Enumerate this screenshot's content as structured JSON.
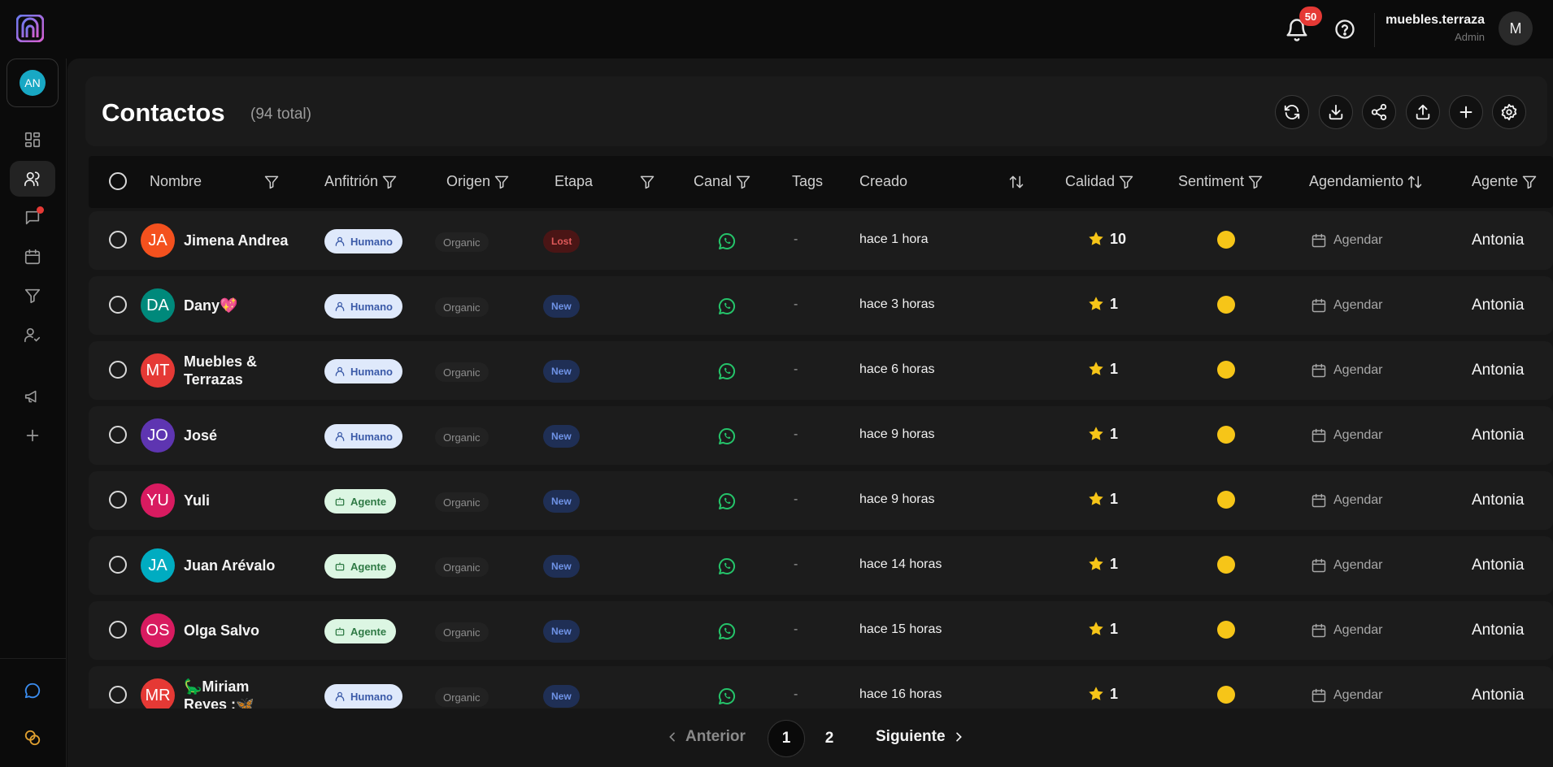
{
  "header": {
    "notification_count": "50",
    "username": "muebles.terraza",
    "role": "Admin",
    "user_initial": "M"
  },
  "sidebar": {
    "workspace_initials": "AN",
    "items": [
      {
        "icon": "dashboard-icon"
      },
      {
        "icon": "contacts-icon",
        "active": true
      },
      {
        "icon": "chat-icon",
        "notification": true
      },
      {
        "icon": "calendar-icon"
      },
      {
        "icon": "funnel-icon"
      },
      {
        "icon": "user-check-icon"
      },
      {
        "icon": "megaphone-icon"
      },
      {
        "icon": "plus-icon"
      },
      {
        "icon": "chat-bubble-icon"
      },
      {
        "icon": "coins-icon"
      }
    ]
  },
  "page": {
    "title": "Contactos",
    "count_label": "(94 total)"
  },
  "table": {
    "columns": {
      "name": "Nombre",
      "host": "Anfitrión",
      "origin": "Origen",
      "stage": "Etapa",
      "channel": "Canal",
      "tags": "Tags",
      "created": "Creado",
      "quality": "Calidad",
      "sentiment": "Sentiment",
      "scheduling": "Agendamiento",
      "agent": "Agente"
    },
    "rows": [
      {
        "initials": "JA",
        "avatar_color": "#f4511e",
        "name": "Jimena Andrea",
        "host": "Humano",
        "origin": "Organic",
        "stage": "Lost",
        "tags": "-",
        "created": "hace 1 hora",
        "quality": "10",
        "schedule": "Agendar",
        "agent": "Antonia"
      },
      {
        "initials": "DA",
        "avatar_color": "#00897b",
        "name": "Dany💖",
        "host": "Humano",
        "origin": "Organic",
        "stage": "New",
        "tags": "-",
        "created": "hace 3 horas",
        "quality": "1",
        "schedule": "Agendar",
        "agent": "Antonia"
      },
      {
        "initials": "MT",
        "avatar_color": "#e53935",
        "name": "Muebles & Terrazas",
        "host": "Humano",
        "origin": "Organic",
        "stage": "New",
        "tags": "-",
        "created": "hace 6 horas",
        "quality": "1",
        "schedule": "Agendar",
        "agent": "Antonia"
      },
      {
        "initials": "JO",
        "avatar_color": "#5e35b1",
        "name": "José",
        "host": "Humano",
        "origin": "Organic",
        "stage": "New",
        "tags": "-",
        "created": "hace 9 horas",
        "quality": "1",
        "schedule": "Agendar",
        "agent": "Antonia"
      },
      {
        "initials": "YU",
        "avatar_color": "#d81b60",
        "name": "Yuli",
        "host": "Agente",
        "origin": "Organic",
        "stage": "New",
        "tags": "-",
        "created": "hace 9 horas",
        "quality": "1",
        "schedule": "Agendar",
        "agent": "Antonia"
      },
      {
        "initials": "JA",
        "avatar_color": "#00acc1",
        "name": "Juan Arévalo",
        "host": "Agente",
        "origin": "Organic",
        "stage": "New",
        "tags": "-",
        "created": "hace 14 horas",
        "quality": "1",
        "schedule": "Agendar",
        "agent": "Antonia"
      },
      {
        "initials": "OS",
        "avatar_color": "#d81b60",
        "name": "Olga Salvo",
        "host": "Agente",
        "origin": "Organic",
        "stage": "New",
        "tags": "-",
        "created": "hace 15 horas",
        "quality": "1",
        "schedule": "Agendar",
        "agent": "Antonia"
      },
      {
        "initials": "MR",
        "avatar_color": "#e53935",
        "name": "🦕Miriam Reyes :🦋",
        "host": "Humano",
        "origin": "Organic",
        "stage": "New",
        "tags": "-",
        "created": "hace 16 horas",
        "quality": "1",
        "schedule": "Agendar",
        "agent": "Antonia"
      }
    ]
  },
  "pagination": {
    "prev": "Anterior",
    "next": "Siguiente",
    "pages": [
      "1",
      "2"
    ],
    "current": "1"
  },
  "colors": {
    "accent_whatsapp": "#25c46a",
    "star": "#f6c518",
    "sentiment_neutral": "#f6c518",
    "badge": "#e53935"
  }
}
